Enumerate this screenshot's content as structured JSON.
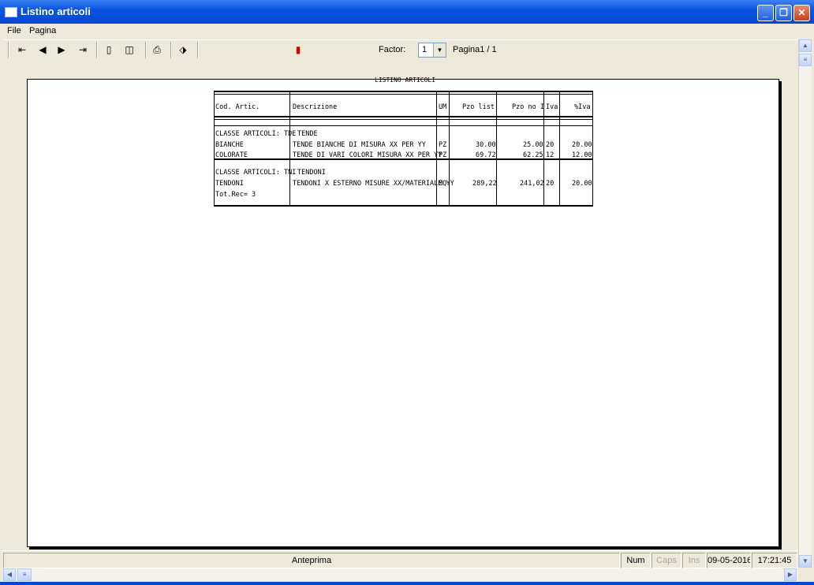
{
  "window": {
    "title": "Listino articoli"
  },
  "menu": {
    "file": "File",
    "pagina": "Pagina"
  },
  "toolbar": {
    "first_icon": "first-page-icon",
    "prev_icon": "prev-page-icon",
    "next_icon": "next-page-icon",
    "last_icon": "last-page-icon",
    "factor_label": "Factor:",
    "factor_value": "1",
    "page_info": "Pagina1 / 1"
  },
  "report": {
    "title": "LISTINO ARTICOLI",
    "headers": [
      "Cod. Artic.",
      "Descrizione",
      "UM",
      "Pzo list.",
      "Pzo no I",
      "Iva",
      "%Iva"
    ],
    "group1": {
      "label": "CLASSE ARTICOLI: TDE",
      "desc": "TENDE",
      "rows": [
        {
          "code": "BIANCHE",
          "desc": "TENDE BIANCHE DI MISURA XX PER YY",
          "um": "PZ",
          "list": "30.00",
          "noiva": "25.00",
          "iva": "20",
          "piva": "20.00"
        },
        {
          "code": "COLORATE",
          "desc": "TENDE DI VARI COLORI MISURA XX PER YY",
          "um": "PZ",
          "list": "69.72",
          "noiva": "62.25",
          "iva": "12",
          "piva": "12.00"
        }
      ]
    },
    "group2": {
      "label": "CLASSE ARTICOLI: TNI",
      "desc": "TENDONI",
      "rows": [
        {
          "code": "TENDONI",
          "desc": "TENDONI X ESTERNO MISURE XX/MATERIALE YY",
          "um": "MQ",
          "list": "289,22",
          "noiva": "241,02",
          "iva": "20",
          "piva": "20.00"
        }
      ]
    },
    "total": "Tot.Rec= 3"
  },
  "status": {
    "main": "Anteprima",
    "num": "Num",
    "caps": "Caps",
    "ins": "Ins",
    "date": "09-05-2016",
    "time": "17:21:45"
  }
}
